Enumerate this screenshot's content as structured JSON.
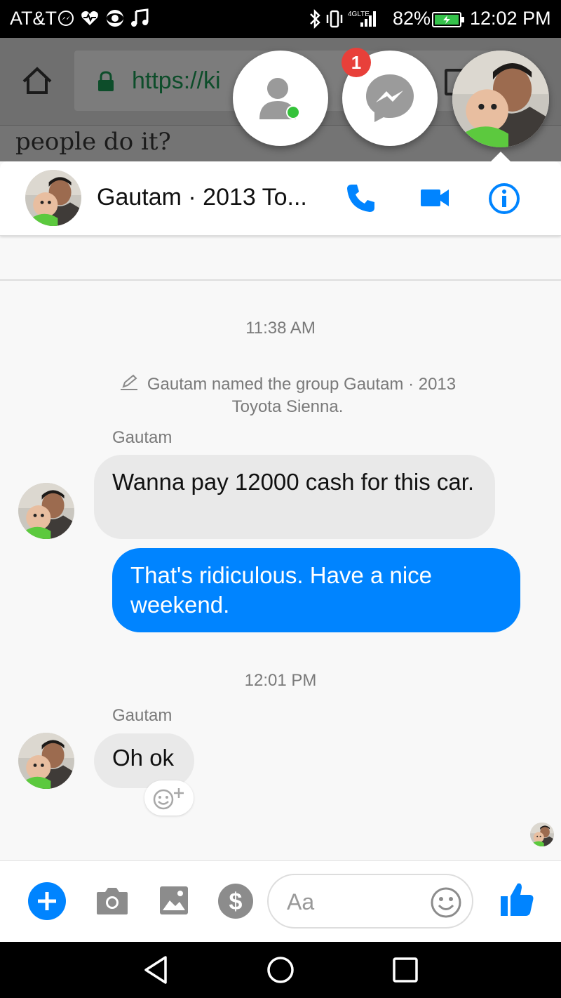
{
  "status_bar": {
    "carrier": "AT&T",
    "battery_pct": "82%",
    "time": "12:02 PM",
    "network": "4G LTE"
  },
  "browser": {
    "url": "https://ki",
    "page_text": "people do it?"
  },
  "chat_heads": {
    "badge_count": "1"
  },
  "conversation": {
    "title": "Gautam · 2013 To...",
    "accent_color": "#0084ff",
    "timestamp_1": "11:38 AM",
    "system_message": "Gautam named the group Gautam · 2013 Toyota Sienna.",
    "sender_1": "Gautam",
    "message_1": "Wanna pay 12000 cash for this car.",
    "message_2": "That's ridiculous. Have a nice weekend.",
    "timestamp_2": "12:01 PM",
    "sender_2": "Gautam",
    "message_3": "Oh ok"
  },
  "composer": {
    "placeholder": "Aa"
  },
  "icons": {
    "call": "phone-icon",
    "video": "video-camera-icon",
    "info": "info-icon",
    "plus": "plus-icon",
    "camera": "camera-icon",
    "gallery": "image-icon",
    "payment": "dollar-icon",
    "emoji": "smiley-icon",
    "like": "thumbs-up-icon"
  }
}
